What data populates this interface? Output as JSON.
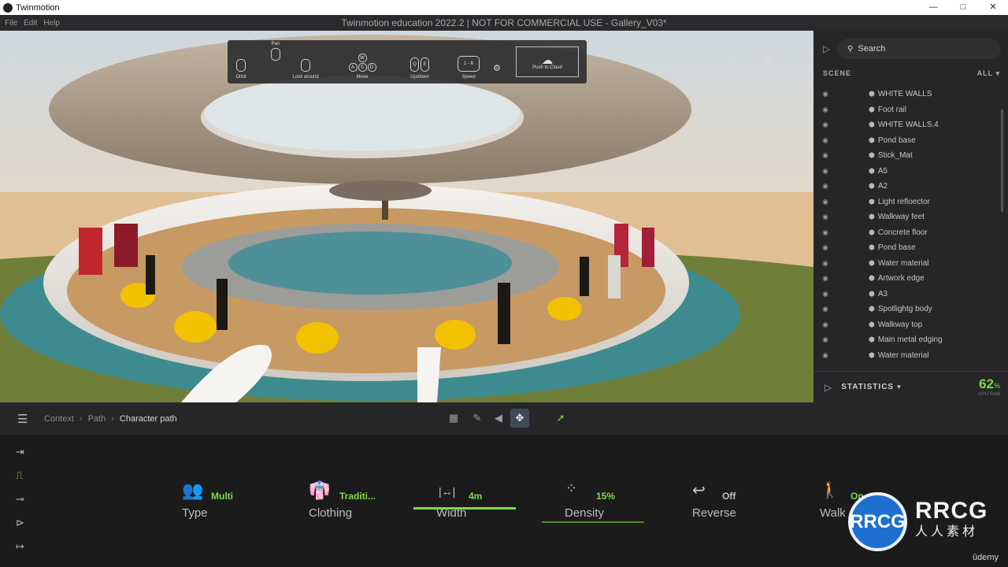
{
  "window": {
    "app_name": "Twinmotion",
    "minimize": "—",
    "maximize": "□",
    "close": "✕"
  },
  "menubar": {
    "menus": [
      "File",
      "Edit",
      "Help"
    ],
    "document_title": "Twinmotion education 2022.2 | NOT FOR COMMERCIAL USE - Gallery_V03*"
  },
  "nav_toolbar": {
    "orbit": "Orbit",
    "pan": "Pan",
    "look_around": "Look around",
    "move": "Move",
    "move_keys": [
      "W",
      "A",
      "S",
      "D"
    ],
    "updown": "Up/down",
    "updown_keys": [
      "Q",
      "E"
    ],
    "speed": "Speed",
    "speed_range": "1 - 6",
    "push_to_cloud": "Push to Cloud"
  },
  "scene_panel": {
    "search_placeholder": "Search",
    "header": "SCENE",
    "filter": "ALL",
    "items": [
      "WHITE WALLS",
      "Foot rail",
      "WHITE WALLS.4",
      "Pond base",
      "Stick_Mat",
      "A5",
      "A2",
      "Light refloector",
      "Walkway feet",
      "Concrete floor",
      "Pond base",
      "Water material",
      "Artwork edge",
      "A3",
      "Spotlightg body",
      "Walkway top",
      "Main metal edging",
      "Water material"
    ],
    "statistics_label": "STATISTICS",
    "gpu_value": "62",
    "gpu_unit": "%",
    "gpu_sub": "GPU RAM"
  },
  "breadcrumb": {
    "items": [
      "Context",
      "Path",
      "Character path"
    ]
  },
  "path_params": {
    "type": {
      "label": "Type",
      "value": "Multi"
    },
    "clothing": {
      "label": "Clothing",
      "value": "Traditi..."
    },
    "width": {
      "label": "Width",
      "value": "4m"
    },
    "density": {
      "label": "Density",
      "value": "15%",
      "level_percent": 15
    },
    "reverse": {
      "label": "Reverse",
      "value": "Off"
    },
    "walk": {
      "label": "Walk",
      "value": "On"
    }
  },
  "watermark": {
    "logo": "RRCG",
    "text": "RRCG",
    "subtext": "人人素材"
  },
  "footer": {
    "brand": "ūdemy"
  },
  "colors": {
    "accent_green": "#7fd94a",
    "panel_bg": "#262628",
    "bottom_bg": "#1b1b1c"
  }
}
